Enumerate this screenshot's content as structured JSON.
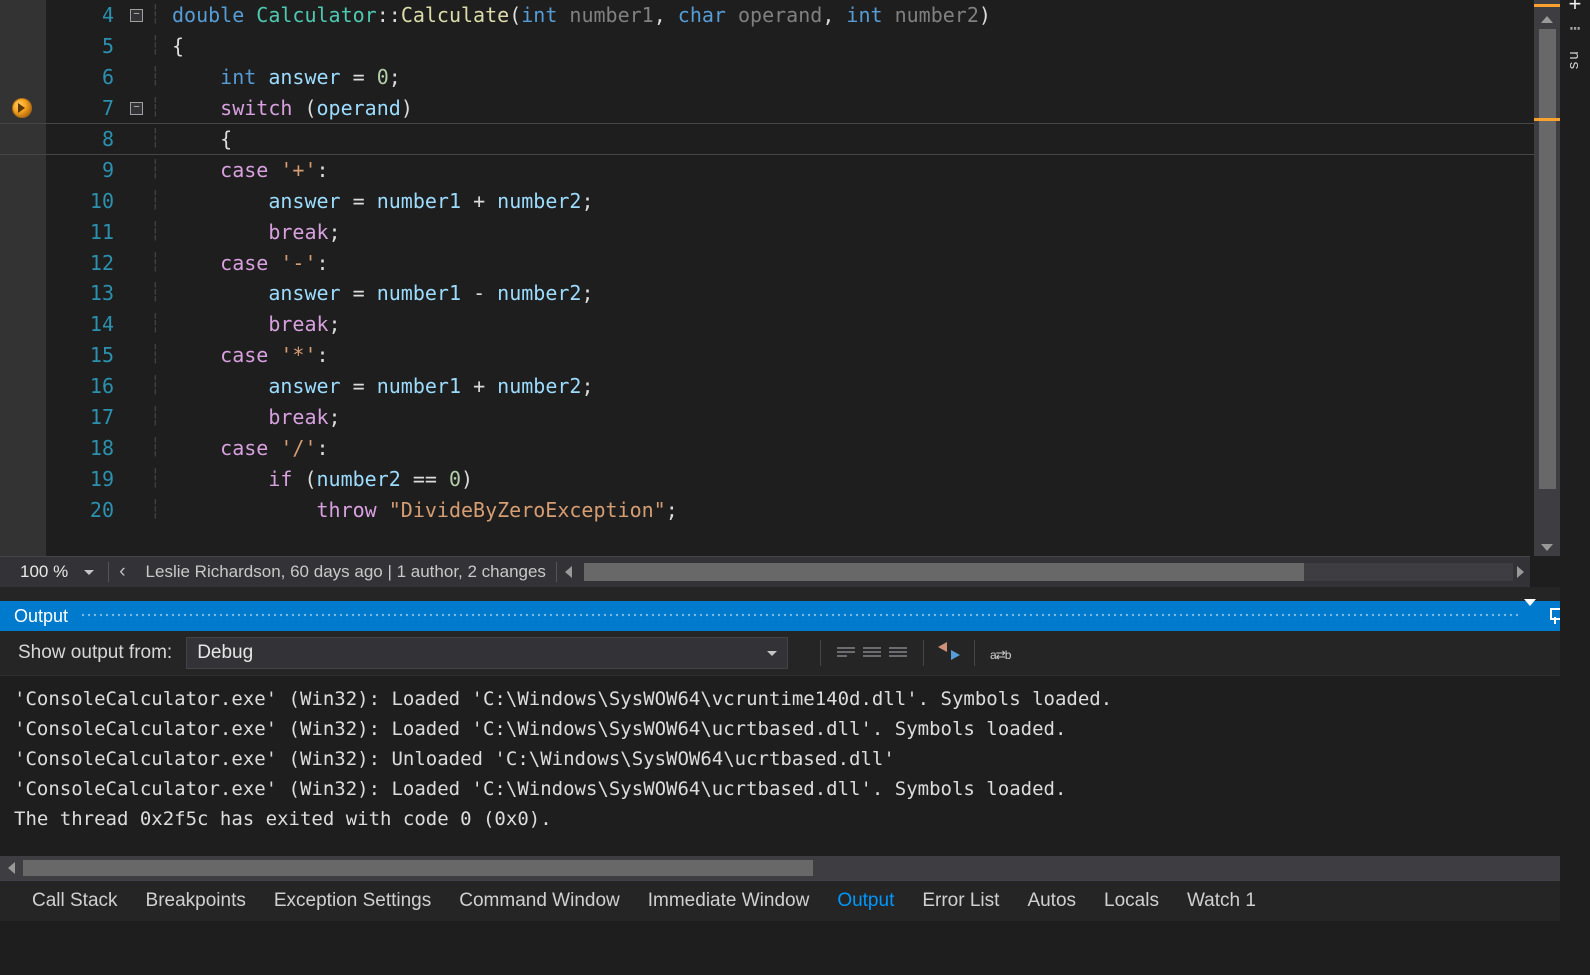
{
  "editor": {
    "zoom": "100 %",
    "status_info": "Leslie Richardson, 60 days ago | 1 author, 2 changes",
    "breakpoint_line": 7,
    "lines": [
      {
        "n": 4,
        "fold": "minus",
        "html": "<span class='tok-kw'>double</span> <span class='tok-type'>Calculator</span><span class='tok-punc'>::</span><span class='tok-fn'>Calculate</span><span class='tok-punc'>(</span><span class='tok-kw'>int</span> <span class='tok-pl'>number1</span><span class='tok-punc'>,</span> <span class='tok-kw'>char</span> <span class='tok-pl'>operand</span><span class='tok-punc'>,</span> <span class='tok-kw'>int</span> <span class='tok-pl'>number2</span><span class='tok-punc'>)</span>"
      },
      {
        "n": 5,
        "html": "<span class='tok-punc'>{</span>"
      },
      {
        "n": 6,
        "html": "    <span class='tok-kw'>int</span> <span class='tok-var'>answer</span> <span class='tok-op'>=</span> <span class='tok-num'>0</span><span class='tok-punc'>;</span>"
      },
      {
        "n": 7,
        "fold": "minus",
        "current": true,
        "html": "    <span class='tok-flow'>switch</span> <span class='tok-punc'>(</span><span class='tok-var'>operand</span><span class='tok-punc'>)</span>"
      },
      {
        "n": 8,
        "html": "    <span class='tok-punc'>{</span>"
      },
      {
        "n": 9,
        "html": "    <span class='tok-flow'>case</span> <span class='tok-str'>'+'</span><span class='tok-punc'>:</span>"
      },
      {
        "n": 10,
        "html": "        <span class='tok-var'>answer</span> <span class='tok-op'>=</span> <span class='tok-var'>number1</span> <span class='tok-op'>+</span> <span class='tok-var'>number2</span><span class='tok-punc'>;</span>"
      },
      {
        "n": 11,
        "html": "        <span class='tok-flow'>break</span><span class='tok-punc'>;</span>"
      },
      {
        "n": 12,
        "html": "    <span class='tok-flow'>case</span> <span class='tok-str'>'-'</span><span class='tok-punc'>:</span>"
      },
      {
        "n": 13,
        "html": "        <span class='tok-var'>answer</span> <span class='tok-op'>=</span> <span class='tok-var'>number1</span> <span class='tok-op'>-</span> <span class='tok-var'>number2</span><span class='tok-punc'>;</span>"
      },
      {
        "n": 14,
        "html": "        <span class='tok-flow'>break</span><span class='tok-punc'>;</span>"
      },
      {
        "n": 15,
        "html": "    <span class='tok-flow'>case</span> <span class='tok-str'>'*'</span><span class='tok-punc'>:</span>"
      },
      {
        "n": 16,
        "html": "        <span class='tok-var'>answer</span> <span class='tok-op'>=</span> <span class='tok-var'>number1</span> <span class='tok-op'>+</span> <span class='tok-var'>number2</span><span class='tok-punc'>;</span>"
      },
      {
        "n": 17,
        "html": "        <span class='tok-flow'>break</span><span class='tok-punc'>;</span>"
      },
      {
        "n": 18,
        "html": "    <span class='tok-flow'>case</span> <span class='tok-str'>'/'</span><span class='tok-punc'>:</span>"
      },
      {
        "n": 19,
        "html": "        <span class='tok-flow'>if</span> <span class='tok-punc'>(</span><span class='tok-var'>number2</span> <span class='tok-op'>==</span> <span class='tok-num'>0</span><span class='tok-punc'>)</span>"
      },
      {
        "n": 20,
        "html": "            <span class='tok-flow'>throw</span> <span class='tok-str'>\"DivideByZeroException\"</span><span class='tok-punc'>;</span>"
      }
    ]
  },
  "output_panel": {
    "title": "Output",
    "show_label": "Show output from:",
    "source": "Debug",
    "lines": [
      "'ConsoleCalculator.exe' (Win32): Loaded 'C:\\Windows\\SysWOW64\\vcruntime140d.dll'. Symbols loaded.",
      "'ConsoleCalculator.exe' (Win32): Loaded 'C:\\Windows\\SysWOW64\\ucrtbased.dll'. Symbols loaded.",
      "'ConsoleCalculator.exe' (Win32): Unloaded 'C:\\Windows\\SysWOW64\\ucrtbased.dll'",
      "'ConsoleCalculator.exe' (Win32): Loaded 'C:\\Windows\\SysWOW64\\ucrtbased.dll'. Symbols loaded.",
      "The thread 0x2f5c has exited with code 0 (0x0)."
    ]
  },
  "bottom_tabs": {
    "items": [
      "Call Stack",
      "Breakpoints",
      "Exception Settings",
      "Command Window",
      "Immediate Window",
      "Output",
      "Error List",
      "Autos",
      "Locals",
      "Watch 1"
    ],
    "active": "Output"
  },
  "right_rail": {
    "text": "su"
  }
}
